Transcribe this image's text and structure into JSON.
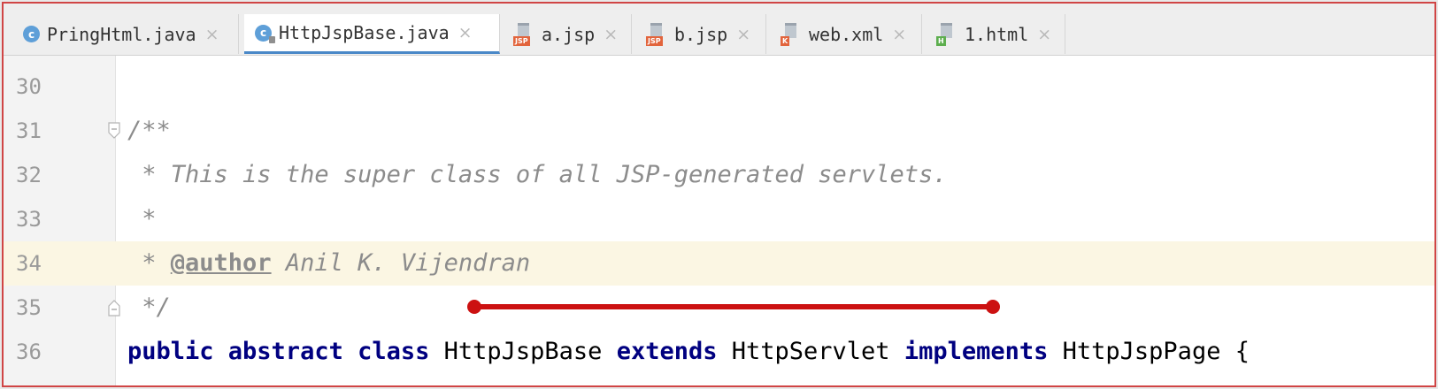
{
  "tabs": [
    {
      "label": "PringHtml.java",
      "icon": "java-class-icon",
      "active": false
    },
    {
      "label": "HttpJspBase.java",
      "icon": "java-class-readonly-icon",
      "active": true
    },
    {
      "label": "a.jsp",
      "icon": "jsp-file-icon",
      "active": false,
      "badge": "JSP"
    },
    {
      "label": "b.jsp",
      "icon": "jsp-file-icon",
      "active": false,
      "badge": "JSP"
    },
    {
      "label": "web.xml",
      "icon": "xml-file-icon",
      "active": false,
      "badge": "K"
    },
    {
      "label": "1.html",
      "icon": "html-file-icon",
      "active": false,
      "badge": "H"
    }
  ],
  "class_icon_letter": "c",
  "close_glyph": "×",
  "editor": {
    "current_line": 34,
    "lines": [
      {
        "number": "30"
      },
      {
        "number": "31",
        "comment": "/**"
      },
      {
        "number": "32",
        "comment": " * This is the super class of all JSP-generated servlets."
      },
      {
        "number": "33",
        "comment": " *"
      },
      {
        "number": "34",
        "comment_prefix": " * ",
        "tag": "@author",
        "comment_rest": " Anil K. Vijendran"
      },
      {
        "number": "35",
        "comment": " */"
      },
      {
        "number": "36",
        "tokens": [
          {
            "text": "public abstract class ",
            "style": "keyword"
          },
          {
            "text": "HttpJspBase ",
            "style": "plain"
          },
          {
            "text": "extends ",
            "style": "keyword"
          },
          {
            "text": "HttpServlet ",
            "style": "plain"
          },
          {
            "text": "implements ",
            "style": "keyword"
          },
          {
            "text": "HttpJspPage {",
            "style": "plain"
          }
        ]
      }
    ]
  },
  "colors": {
    "keyword": "#000080",
    "comment": "#8c8c8c",
    "active_tab_accent": "#4a88c7",
    "annotation_red": "#cc1111",
    "current_line": "#fbf6e3"
  }
}
